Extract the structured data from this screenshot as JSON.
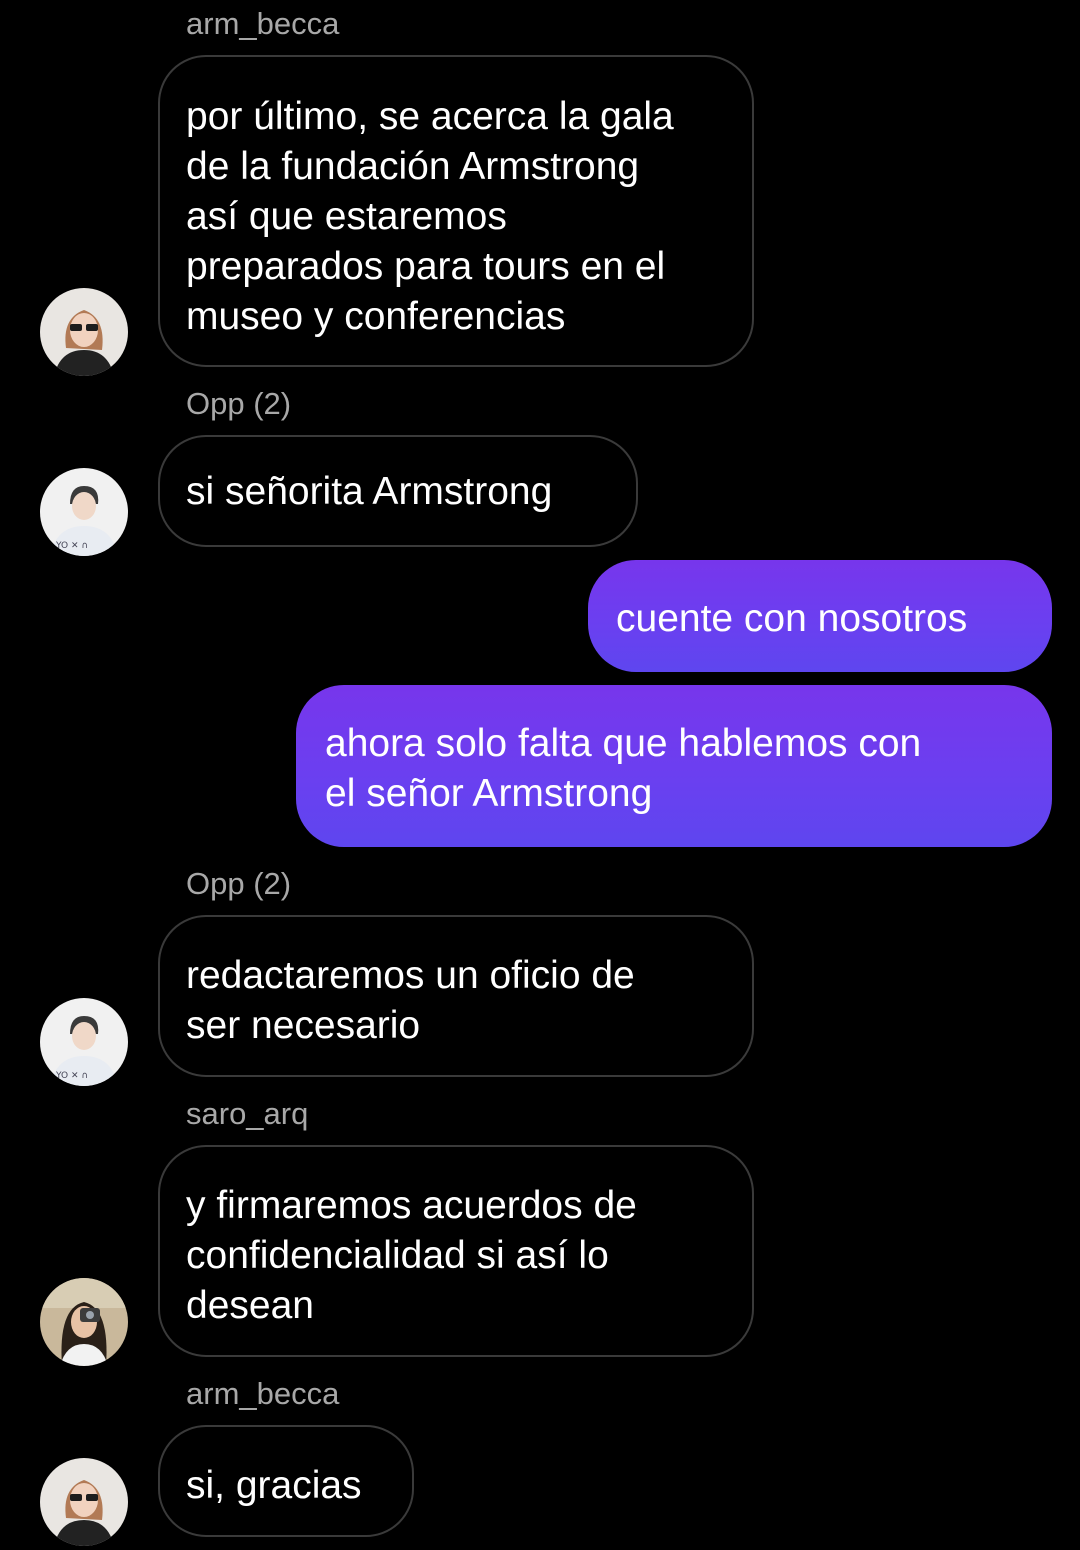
{
  "colors": {
    "background": "#000000",
    "incoming_border": "#3a3a3a",
    "sender_name": "#a8a8a8",
    "outgoing_top": "#7736ec",
    "outgoing_bottom": "#5e46ef"
  },
  "messages": [
    {
      "sender": "arm_becca",
      "text": "por último, se acerca la gala\nde la fundación Armstrong\nasí que estaremos\npreparados para tours en el\nmuseo y conferencias",
      "avatar": "avatar-arm-becca"
    },
    {
      "sender": "Opp (2)",
      "text": "si señorita Armstrong",
      "avatar": "avatar-opp"
    },
    {
      "outgoing": true,
      "text": "cuente con nosotros"
    },
    {
      "outgoing": true,
      "text": "ahora solo falta que hablemos con\nel señor Armstrong"
    },
    {
      "sender": "Opp (2)",
      "text": "redactaremos un oficio de\nser necesario",
      "avatar": "avatar-opp"
    },
    {
      "sender": "saro_arq",
      "text": "y firmaremos acuerdos de\nconfidencialidad si así lo\ndesean",
      "avatar": "avatar-saro-arq"
    },
    {
      "sender": "arm_becca",
      "text": "si, gracias",
      "avatar": "avatar-arm-becca"
    }
  ]
}
